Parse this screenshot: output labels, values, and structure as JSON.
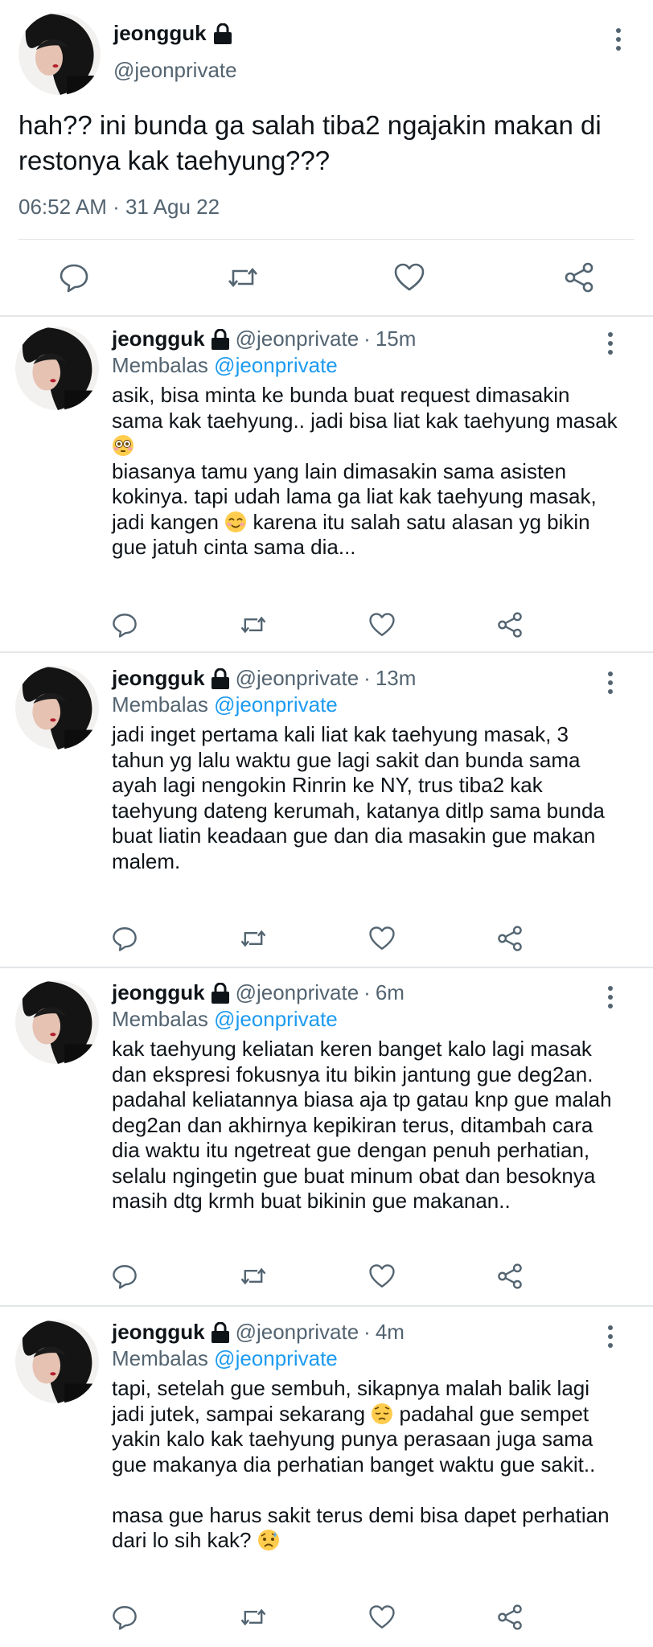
{
  "colors": {
    "text": "#0f1419",
    "muted": "#536471",
    "link": "#1d9bf0",
    "divider": "#e3e6e8"
  },
  "main_tweet": {
    "display_name": "jeongguk",
    "handle": "@jeonprivate",
    "text": "hah?? ini bunda ga salah tiba2 ngajakin makan di restonya kak taehyung???",
    "timestamp": "06:52 AM · 31 Agu 22",
    "icons": [
      "lock-icon",
      "more-icon",
      "reply-icon",
      "retweet-icon",
      "like-icon",
      "share-icon"
    ]
  },
  "replies": [
    {
      "display_name": "jeongguk",
      "handle": "@jeonprivate",
      "time": "15m",
      "replying_prefix": "Membalas",
      "replying_to": "@jeonprivate",
      "text_1": "asik, bisa minta ke bunda buat request dimasakin sama kak taehyung.. jadi bisa liat kak taehyung masak",
      "emoji_1": "flushed-face-emoji",
      "text_2": "\nbiasanya tamu yang lain dimasakin sama asisten kokinya. tapi udah lama ga liat kak taehyung masak, jadi kangen",
      "emoji_2": "smiling-eyes-emoji",
      "text_3": " karena itu salah satu alasan yg bikin gue jatuh cinta sama dia..."
    },
    {
      "display_name": "jeongguk",
      "handle": "@jeonprivate",
      "time": "13m",
      "replying_prefix": "Membalas",
      "replying_to": "@jeonprivate",
      "text_1": "jadi inget pertama kali liat kak taehyung masak, 3 tahun yg lalu waktu gue lagi sakit dan bunda sama ayah lagi nengokin Rinrin ke NY, trus tiba2 kak taehyung dateng kerumah, katanya ditlp sama bunda buat liatin keadaan gue dan dia masakin gue makan malem."
    },
    {
      "display_name": "jeongguk",
      "handle": "@jeonprivate",
      "time": "6m",
      "replying_prefix": "Membalas",
      "replying_to": "@jeonprivate",
      "text_1": "kak taehyung keliatan keren banget kalo lagi masak dan ekspresi fokusnya itu bikin jantung gue deg2an. padahal keliatannya biasa aja tp gatau knp gue malah deg2an dan akhirnya kepikiran terus, ditambah cara dia waktu itu ngetreat gue dengan penuh perhatian, selalu ngingetin gue buat minum obat dan besoknya masih dtg krmh buat bikinin gue makanan.."
    },
    {
      "display_name": "jeongguk",
      "handle": "@jeonprivate",
      "time": "4m",
      "replying_prefix": "Membalas",
      "replying_to": "@jeonprivate",
      "text_1": "tapi, setelah gue sembuh, sikapnya malah balik lagi jadi jutek, sampai sekarang",
      "emoji_1": "pensive-face-emoji",
      "text_2": " padahal gue sempet yakin kalo kak taehyung punya perasaan juga sama gue makanya dia perhatian banget waktu gue sakit..\n\nmasa gue harus sakit terus demi bisa dapet perhatian dari lo sih kak?",
      "emoji_2": "disappointed-relieved-emoji"
    }
  ]
}
